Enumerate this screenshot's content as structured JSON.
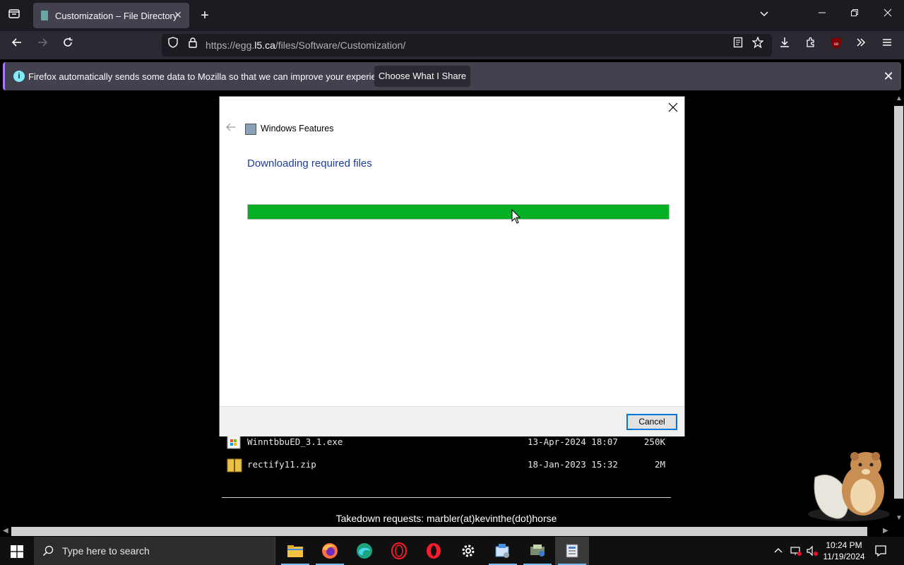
{
  "browser": {
    "tab": {
      "title": "Customization – File Directory"
    },
    "url": {
      "prefix": "https://egg.",
      "host": "l5.ca",
      "path": "/files/Software/Customization/"
    },
    "notification": {
      "message": "Firefox automatically sends some data to Mozilla so that we can improve your experience.",
      "button_label": "Choose What I Share"
    }
  },
  "page": {
    "files": [
      {
        "name": "WinntbbuED_3.1.exe",
        "date": "13-Apr-2024 18:07",
        "size": "250K",
        "icon": "exe-icon"
      },
      {
        "name": "rectify11.zip",
        "date": "18-Jan-2023 15:32",
        "size": "2M",
        "icon": "zip-icon"
      }
    ],
    "footer_text": "Takedown requests: marbler(at)kevinthe(dot)horse"
  },
  "dialog": {
    "app_title": "Windows Features",
    "heading": "Downloading required files",
    "progress_fraction": 1.0,
    "progress_color": "#06b025",
    "cancel_label": "Cancel"
  },
  "taskbar": {
    "search_placeholder": "Type here to search",
    "time": "10:24 PM",
    "date": "11/19/2024",
    "apps": [
      "file-explorer-icon",
      "firefox-icon",
      "edge-icon",
      "opera-outline-icon",
      "opera-icon",
      "settings-icon",
      "control-panel-icon",
      "windows-update-icon",
      "windows-features-icon"
    ]
  }
}
